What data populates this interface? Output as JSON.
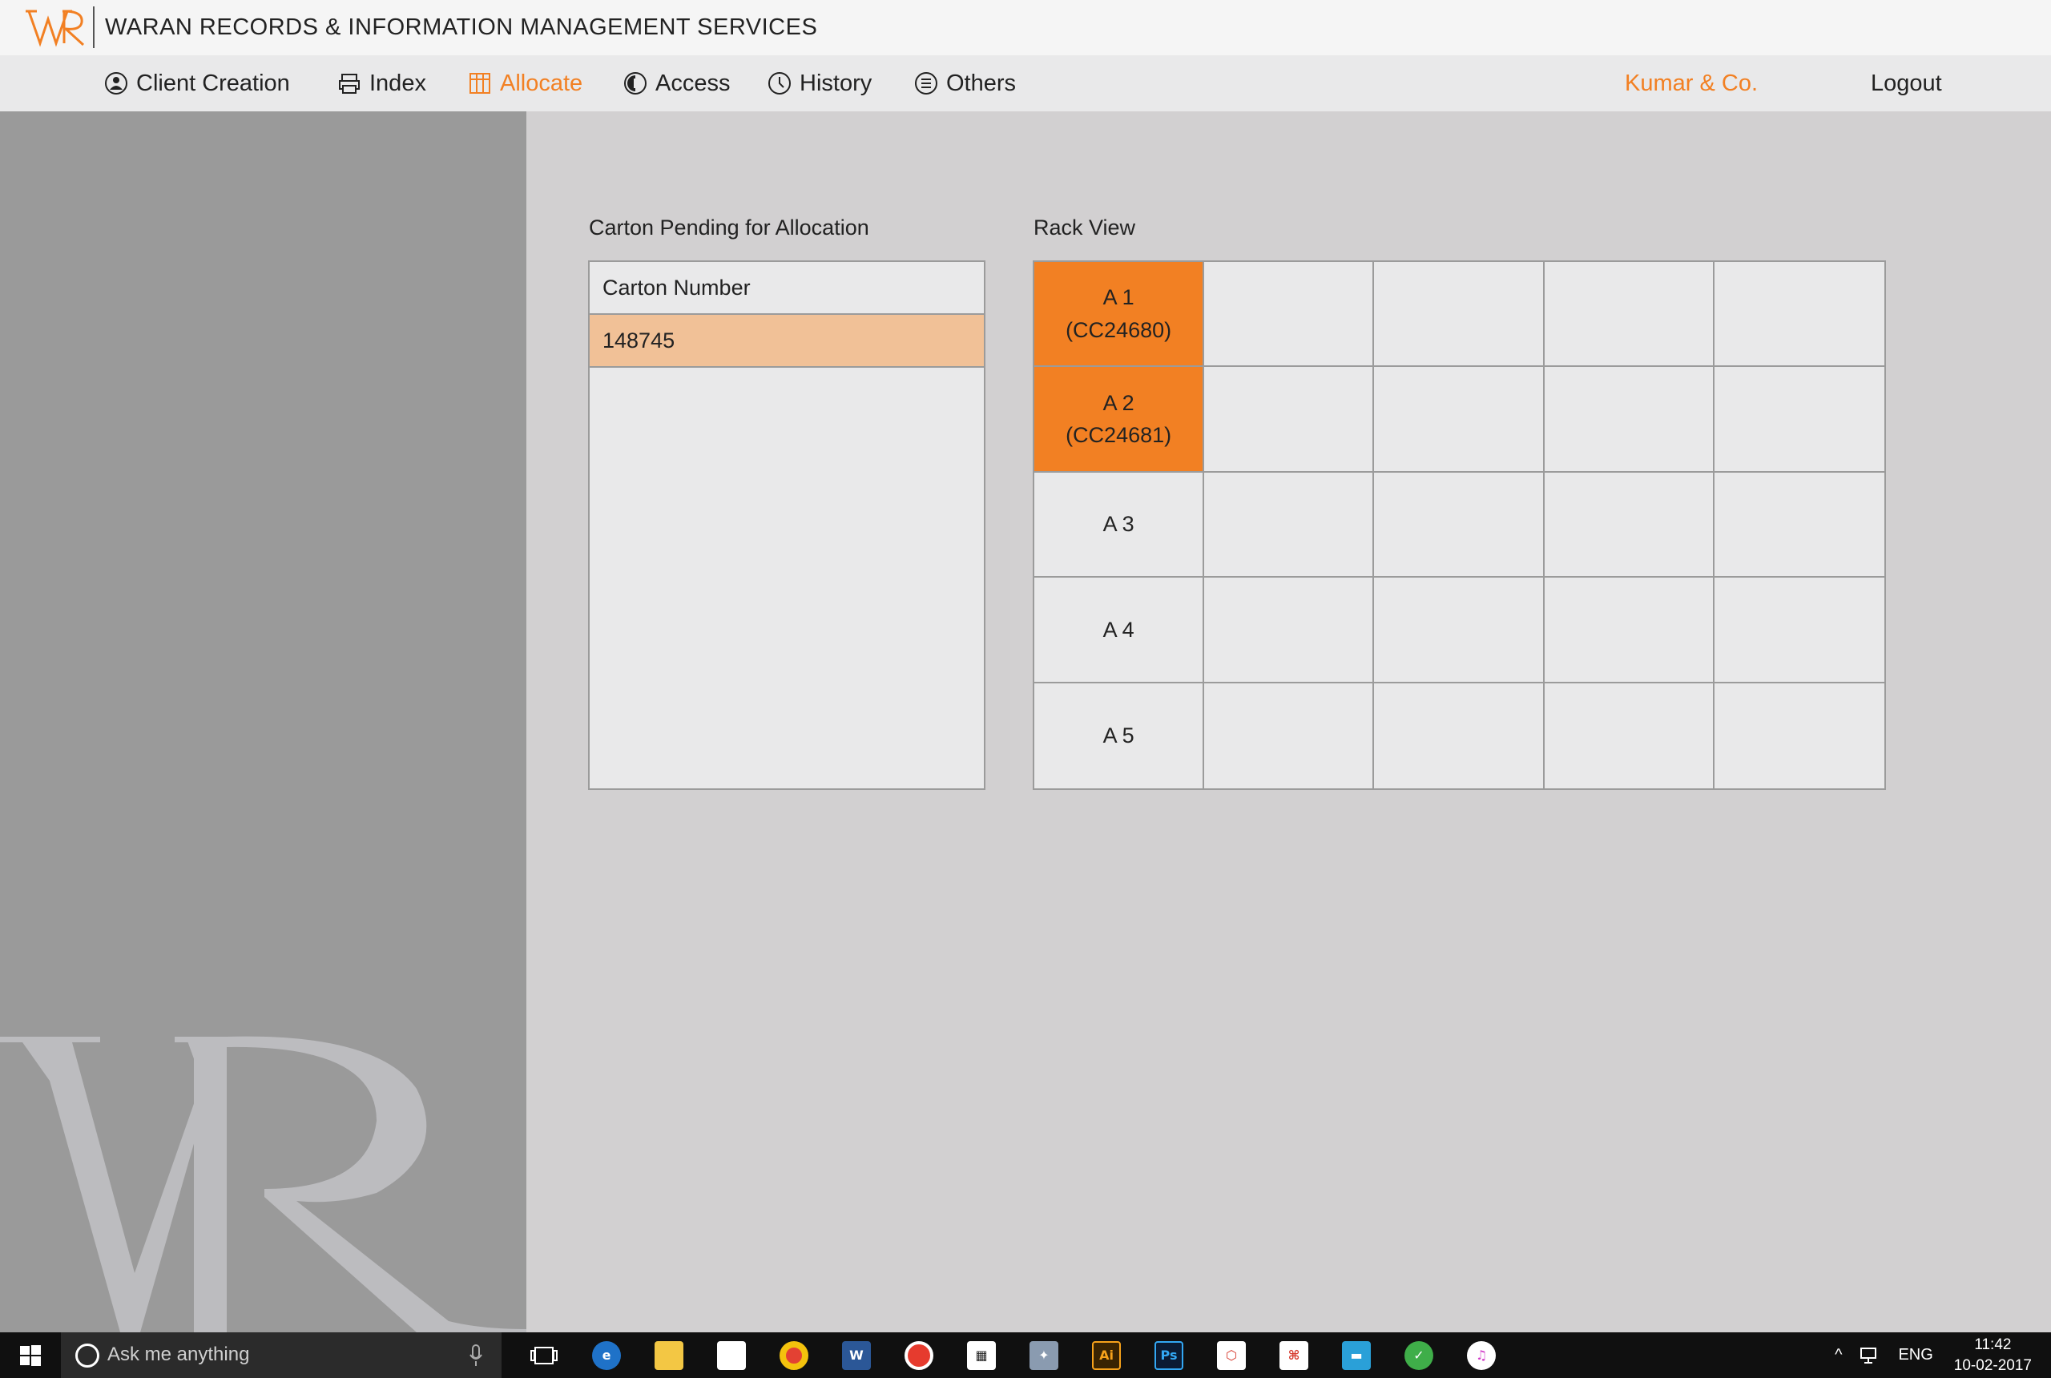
{
  "header": {
    "logo_text": "WR",
    "title": "WARAN RECORDS & INFORMATION MANAGEMENT SERVICES"
  },
  "nav": {
    "items": [
      {
        "label": "Client Creation",
        "icon": "client-icon"
      },
      {
        "label": "Index",
        "icon": "printer-icon"
      },
      {
        "label": "Allocate",
        "icon": "rack-icon",
        "active": true
      },
      {
        "label": "Access",
        "icon": "access-icon"
      },
      {
        "label": "History",
        "icon": "clock-icon"
      },
      {
        "label": "Others",
        "icon": "list-icon"
      }
    ],
    "user": "Kumar & Co.",
    "logout": "Logout"
  },
  "carton_panel": {
    "title": "Carton Pending for Allocation",
    "column_header": "Carton Number",
    "rows": [
      "148745"
    ]
  },
  "rack_view": {
    "title": "Rack View",
    "rows": [
      {
        "label": "A 1",
        "code": "(CC24680)",
        "occupied": true
      },
      {
        "label": "A 2",
        "code": "(CC24681)",
        "occupied": true
      },
      {
        "label": "A 3",
        "code": "",
        "occupied": false
      },
      {
        "label": "A 4",
        "code": "",
        "occupied": false
      },
      {
        "label": "A 5",
        "code": "",
        "occupied": false
      }
    ],
    "columns": 5
  },
  "taskbar": {
    "search_placeholder": "Ask me anything",
    "language": "ENG",
    "time": "11:42",
    "date": "10-02-2017"
  },
  "colors": {
    "accent": "#f28023",
    "selected_row": "#f1c197"
  }
}
